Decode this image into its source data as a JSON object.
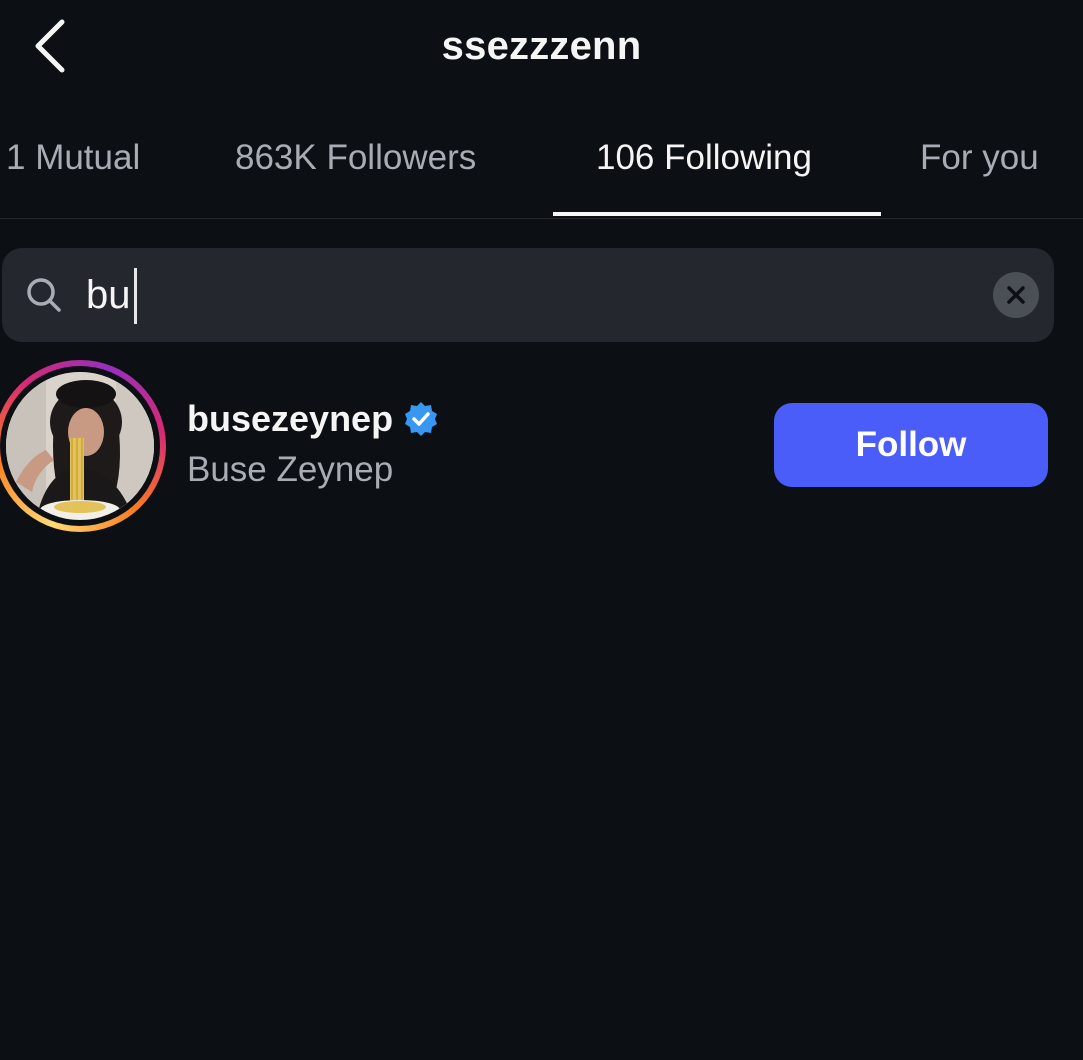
{
  "header": {
    "title": "ssezzzenn",
    "back_icon": "chevron-left-icon"
  },
  "tabs": [
    {
      "label": "1 Mutual",
      "active": false
    },
    {
      "label": "863K Followers",
      "active": false
    },
    {
      "label": "106 Following",
      "active": true
    },
    {
      "label": "For you",
      "active": false
    }
  ],
  "search": {
    "value": "bu",
    "search_icon": "search-icon",
    "clear_icon": "close-icon"
  },
  "results": [
    {
      "username": "busezeynep",
      "verified": true,
      "full_name": "Buse Zeynep",
      "follow_label": "Follow",
      "has_story_ring": true
    }
  ],
  "colors": {
    "background": "#0c1014",
    "follow_button": "#4a5df9",
    "verified_badge": "#3897f0",
    "search_field": "#24272e"
  }
}
